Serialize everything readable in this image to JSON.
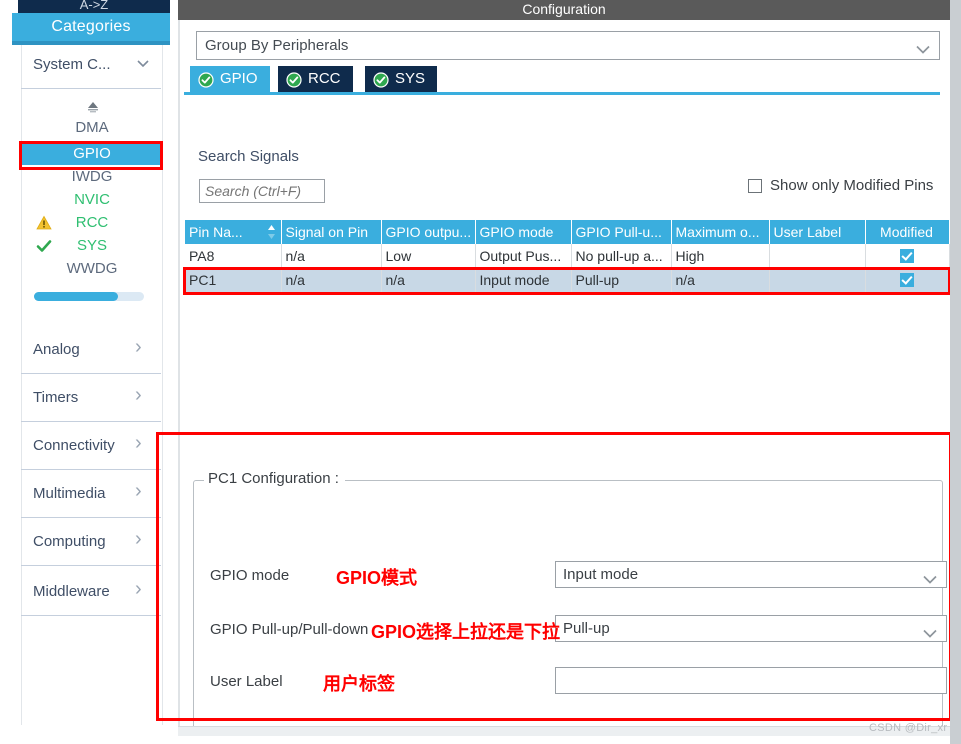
{
  "window": {
    "title": "Configuration",
    "watermark": "CSDN @Dir_xr"
  },
  "sidebar": {
    "az_tab": "A->Z",
    "categories_tab": "Categories",
    "scroll_up_icon": "scroll-up-icon",
    "groups": [
      {
        "label": "System C...",
        "icon": "chevron-down-icon",
        "expanded": true
      },
      {
        "label": "Analog",
        "icon": "chevron-right-icon",
        "expanded": false
      },
      {
        "label": "Timers",
        "icon": "chevron-right-icon",
        "expanded": false
      },
      {
        "label": "Connectivity",
        "icon": "chevron-right-icon",
        "expanded": false
      },
      {
        "label": "Multimedia",
        "icon": "chevron-right-icon",
        "expanded": false
      },
      {
        "label": "Computing",
        "icon": "chevron-right-icon",
        "expanded": false
      },
      {
        "label": "Middleware",
        "icon": "chevron-right-icon",
        "expanded": false
      }
    ],
    "peripherals": [
      {
        "label": "DMA",
        "state": "normal",
        "icon": "",
        "selected": false
      },
      {
        "label": "GPIO",
        "state": "normal",
        "icon": "",
        "selected": true
      },
      {
        "label": "IWDG",
        "state": "normal",
        "icon": "",
        "selected": false
      },
      {
        "label": "NVIC",
        "state": "configured",
        "icon": "",
        "selected": false
      },
      {
        "label": "RCC",
        "state": "configured",
        "icon": "warning-triangle-icon",
        "selected": false
      },
      {
        "label": "SYS",
        "state": "configured",
        "icon": "green-check-icon",
        "selected": false
      },
      {
        "label": "WWDG",
        "state": "normal",
        "icon": "",
        "selected": false
      }
    ]
  },
  "main": {
    "group_by": {
      "value": "Group By Peripherals",
      "chevron": "chevron-down-icon"
    },
    "tabs": [
      {
        "label": "GPIO",
        "icon": "green-check-circle-icon",
        "active": true
      },
      {
        "label": "RCC",
        "icon": "green-check-circle-icon",
        "active": false
      },
      {
        "label": "SYS",
        "icon": "green-check-circle-icon",
        "active": false
      }
    ],
    "search": {
      "heading": "Search Signals",
      "placeholder": "Search (Ctrl+F)",
      "value": ""
    },
    "show_only_modified": {
      "label": "Show only Modified Pins",
      "checked": false
    },
    "table": {
      "columns": [
        "Pin Na...",
        "Signal on Pin",
        "GPIO outpu...",
        "GPIO mode",
        "GPIO Pull-u...",
        "Maximum o...",
        "User Label",
        "Modified"
      ],
      "sort_icon": "sort-arrows-icon",
      "rows": [
        {
          "pin": "PA8",
          "signal": "n/a",
          "output": "Low",
          "mode": "Output Pus...",
          "pull": "No pull-up a...",
          "speed": "High",
          "user_label": "",
          "modified": true,
          "selected": false
        },
        {
          "pin": "PC1",
          "signal": "n/a",
          "output": "n/a",
          "mode": "Input mode",
          "pull": "Pull-up",
          "speed": "n/a",
          "user_label": "",
          "modified": true,
          "selected": true
        }
      ]
    },
    "config": {
      "legend": "PC1 Configuration :",
      "rows": [
        {
          "label": "GPIO mode",
          "annotation": "GPIO模式",
          "value": "Input mode",
          "control": "dropdown",
          "chevron": "chevron-down-icon"
        },
        {
          "label": "GPIO Pull-up/Pull-down",
          "annotation": "GPIO选择上拉还是下拉",
          "value": "Pull-up",
          "control": "dropdown",
          "chevron": "chevron-down-icon"
        },
        {
          "label": "User Label",
          "annotation": "用户标签",
          "value": "",
          "control": "textbox",
          "chevron": ""
        }
      ]
    }
  }
}
